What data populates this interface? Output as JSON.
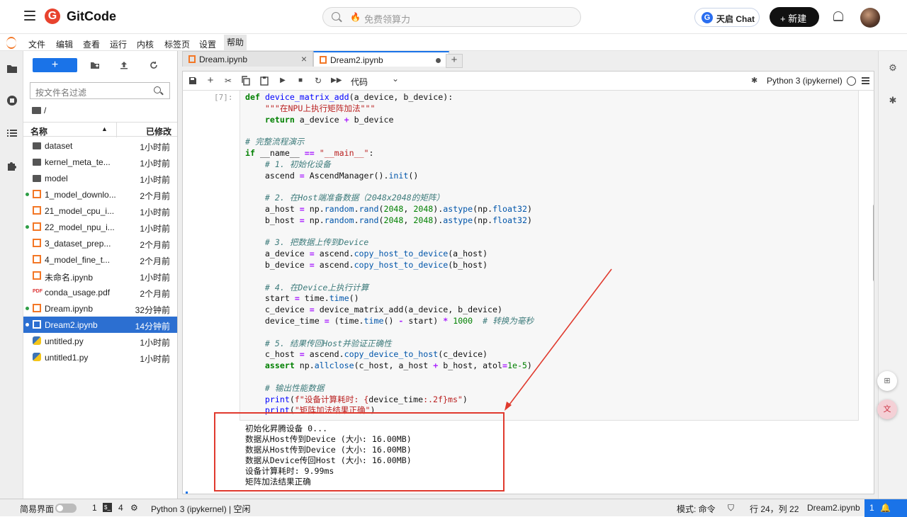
{
  "header": {
    "logo_letter": "G",
    "logo_text": "GitCode",
    "search_placeholder": "免费领算力",
    "chat_button": "天启 Chat",
    "chat_icon_letter": "G",
    "new_button": "+ 新建"
  },
  "menu": [
    "文件",
    "编辑",
    "查看",
    "运行",
    "内核",
    "标签页",
    "设置",
    "帮助"
  ],
  "filebrowser": {
    "new_label": "+",
    "filter_placeholder": "按文件名过滤",
    "path": "/",
    "col_name": "名称",
    "col_modified": "已修改",
    "files": [
      {
        "name": "dataset",
        "time": "1小时前",
        "type": "folder",
        "running": false,
        "selected": false
      },
      {
        "name": "kernel_meta_te...",
        "time": "1小时前",
        "type": "folder",
        "running": false,
        "selected": false
      },
      {
        "name": "model",
        "time": "1小时前",
        "type": "folder",
        "running": false,
        "selected": false
      },
      {
        "name": "1_model_downlo...",
        "time": "2个月前",
        "type": "nb",
        "running": true,
        "selected": false
      },
      {
        "name": "21_model_cpu_i...",
        "time": "1小时前",
        "type": "nb",
        "running": false,
        "selected": false
      },
      {
        "name": "22_model_npu_i...",
        "time": "1小时前",
        "type": "nb",
        "running": true,
        "selected": false
      },
      {
        "name": "3_dataset_prep...",
        "time": "2个月前",
        "type": "nb",
        "running": false,
        "selected": false
      },
      {
        "name": "4_model_fine_t...",
        "time": "2个月前",
        "type": "nb",
        "running": false,
        "selected": false
      },
      {
        "name": "未命名.ipynb",
        "time": "1小时前",
        "type": "nb",
        "running": false,
        "selected": false
      },
      {
        "name": "conda_usage.pdf",
        "time": "2个月前",
        "type": "pdf",
        "running": false,
        "selected": false
      },
      {
        "name": "Dream.ipynb",
        "time": "32分钟前",
        "type": "nb",
        "running": true,
        "selected": false
      },
      {
        "name": "Dream2.ipynb",
        "time": "14分钟前",
        "type": "nb",
        "running": true,
        "selected": true
      },
      {
        "name": "untitled.py",
        "time": "1小时前",
        "type": "py",
        "running": false,
        "selected": false
      },
      {
        "name": "untitled1.py",
        "time": "1小时前",
        "type": "py",
        "running": false,
        "selected": false
      }
    ]
  },
  "tabs": [
    {
      "label": "Dream.ipynb",
      "active": false
    },
    {
      "label": "Dream2.ipynb",
      "active": true
    }
  ],
  "toolbar": {
    "cell_type": "代码",
    "kernel": "Python 3 (ipykernel)"
  },
  "cell": {
    "prompt": "[7]:",
    "output_lines": [
      "初始化昇腾设备 0...",
      "数据从Host传到Device (大小: 16.00MB)",
      "数据从Host传到Device (大小: 16.00MB)",
      "数据从Device传回Host (大小: 16.00MB)",
      "设备计算耗时: 9.99ms",
      "矩阵加法结果正确"
    ]
  },
  "statusbar": {
    "simple_mode": "简易界面",
    "count1": "1",
    "count2": "4",
    "kernel_status": "Python 3 (ipykernel) | 空闲",
    "mode": "模式: 命令",
    "position": "行 24，列 22",
    "file": "Dream2.ipynb",
    "notif_count": "1"
  },
  "colors": {
    "accent": "#1a73e8",
    "annotation_red": "#e03a2e",
    "notebook_orange": "#f37726"
  }
}
